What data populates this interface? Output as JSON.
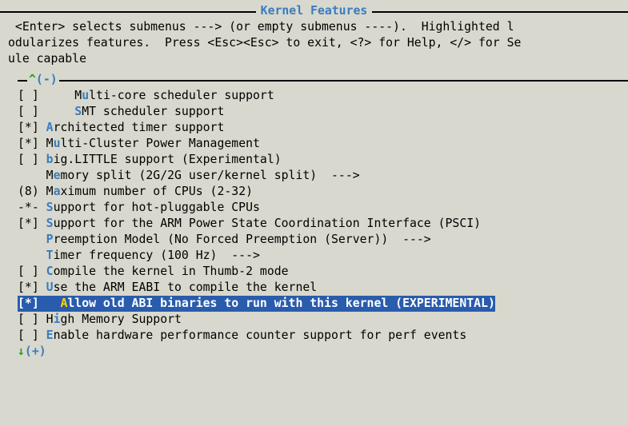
{
  "title": "Kernel Features",
  "help_lines": [
    " <Enter> selects submenus ---> (or empty submenus ----).  Highlighted l",
    "odularizes features.  Press <Esc><Esc> to exit, <?> for Help, </> for Se",
    "ule capable"
  ],
  "scroll_up": {
    "caret": "^",
    "rest": "(-)"
  },
  "scroll_down": {
    "caret": "↓",
    "rest": "(+)"
  },
  "items": [
    {
      "bracket": "[ ]",
      "indent": "    ",
      "pre": "M",
      "hk": "u",
      "post": "lti-core scheduler support"
    },
    {
      "bracket": "[ ]",
      "indent": "    ",
      "pre": "",
      "hk": "S",
      "post": "MT scheduler support"
    },
    {
      "bracket": "[*]",
      "indent": "",
      "pre": "",
      "hk": "A",
      "post": "rchitected timer support"
    },
    {
      "bracket": "[*]",
      "indent": "",
      "pre": "M",
      "hk": "u",
      "post": "lti-Cluster Power Management"
    },
    {
      "bracket": "[ ]",
      "indent": "",
      "pre": "",
      "hk": "b",
      "post": "ig.LITTLE support (Experimental)"
    },
    {
      "bracket": "   ",
      "indent": "",
      "pre": "M",
      "hk": "e",
      "post": "mory split (2G/2G user/kernel split)  --->"
    },
    {
      "bracket": "(8)",
      "indent": "",
      "pre": "M",
      "hk": "a",
      "post": "ximum number of CPUs (2-32)"
    },
    {
      "bracket": "-*-",
      "indent": "",
      "pre": "",
      "hk": "S",
      "post": "upport for hot-pluggable CPUs"
    },
    {
      "bracket": "[*]",
      "indent": "",
      "pre": "",
      "hk": "S",
      "post": "upport for the ARM Power State Coordination Interface (PSCI)"
    },
    {
      "bracket": "   ",
      "indent": "",
      "pre": "",
      "hk": "P",
      "post": "reemption Model (No Forced Preemption (Server))  --->"
    },
    {
      "bracket": "   ",
      "indent": "",
      "pre": "",
      "hk": "T",
      "post": "imer frequency (100 Hz)  --->"
    },
    {
      "bracket": "[ ]",
      "indent": "",
      "pre": "",
      "hk": "C",
      "post": "ompile the kernel in Thumb-2 mode"
    },
    {
      "bracket": "[*]",
      "indent": "",
      "pre": "",
      "hk": "U",
      "post": "se the ARM EABI to compile the kernel"
    },
    {
      "bracket": "[*]",
      "indent": "  ",
      "pre": "",
      "hk": "A",
      "post": "llow old ABI binaries to run with this kernel (EXPERIMENTAL)",
      "selected": true
    },
    {
      "bracket": "[ ]",
      "indent": "",
      "pre": "H",
      "hk": "i",
      "post": "gh Memory Support"
    },
    {
      "bracket": "[ ]",
      "indent": "",
      "pre": "",
      "hk": "E",
      "post": "nable hardware performance counter support for perf events"
    }
  ]
}
